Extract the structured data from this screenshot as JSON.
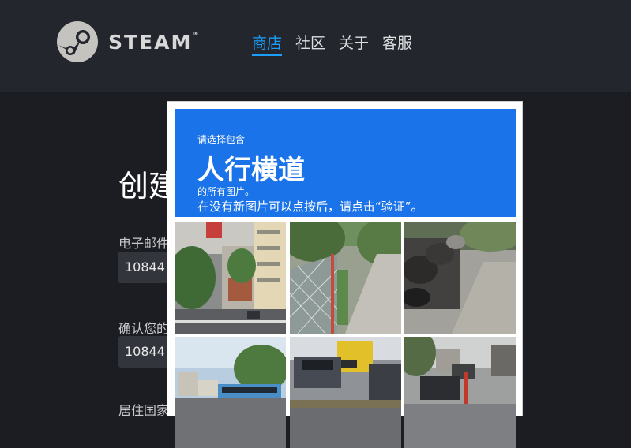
{
  "header": {
    "logo_text": "STEAM",
    "logo_mark": "®",
    "nav": [
      "商店",
      "社区",
      "关于",
      "客服"
    ]
  },
  "form": {
    "title": "创建",
    "email_label": "电子邮件",
    "email_value": "10844",
    "confirm_label": "确认您的",
    "confirm_value": "10844",
    "country_label": "居住国家"
  },
  "captcha": {
    "prompt_prefix": "请选择包含",
    "target": "人行横道",
    "prompt_suffix": "的所有图片。",
    "hint": "在没有新图片可以点按后，请点击“验证”。",
    "tiles": [
      "street-scene",
      "fence-sidewalk",
      "parked-motorbikes",
      "street-bus",
      "traffic-truck",
      "road-cars"
    ]
  },
  "colors": {
    "header_bg": "#23262d",
    "page_bg": "#1b1d22",
    "accent": "#1a9fff",
    "captcha_blue": "#1a73e8"
  }
}
